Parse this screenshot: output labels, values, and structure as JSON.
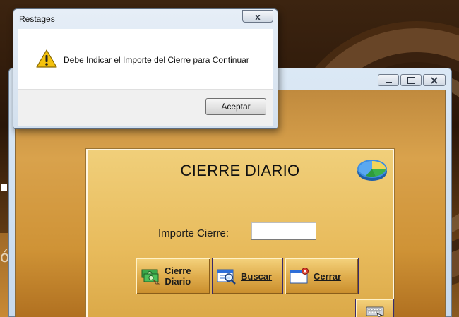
{
  "dialog": {
    "title": "Restages",
    "close_symbol": "x",
    "icon": "warning-icon",
    "message": "Debe Indicar el Importe del Cierre para Continuar",
    "ok_label": "Aceptar"
  },
  "app": {
    "panel_title": "CIERRE DIARIO",
    "field_label": "Importe Cierre:",
    "field_value": "",
    "buttons": {
      "cierre_line1": "Cierre",
      "cierre_line2": "Diario",
      "buscar": "Buscar",
      "cerrar": "Cerrar"
    }
  },
  "background": {
    "glyph": "ó"
  },
  "colors": {
    "panel_bg": "#e8bb5c",
    "client_bg": "#d9a24c",
    "dialog_bg": "#e6eef7",
    "warning_yellow": "#f4c20d"
  }
}
